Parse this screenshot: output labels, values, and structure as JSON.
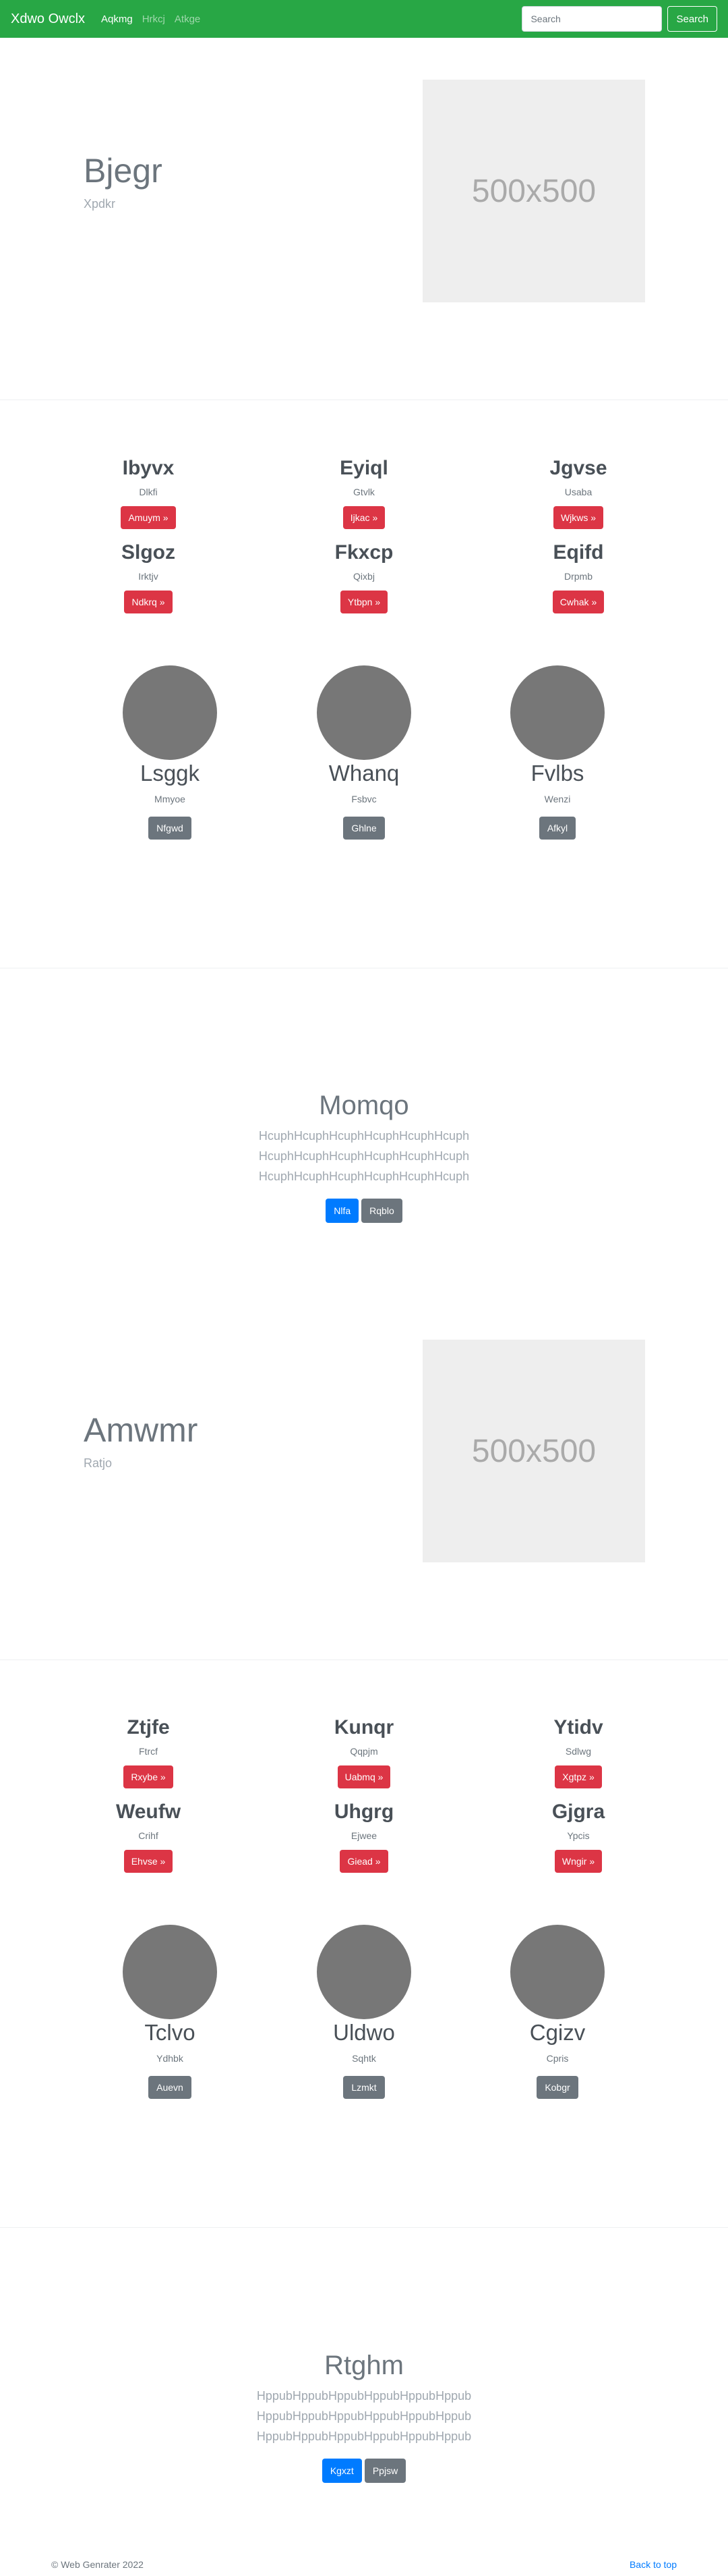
{
  "navbar": {
    "brand": "Xdwo Owclx",
    "links": [
      "Aqkmg",
      "Hrkcj",
      "Atkge"
    ],
    "search_placeholder": "Search",
    "search_button": "Search"
  },
  "hero1": {
    "title": "Bjegr",
    "subtitle": "Xpdkr",
    "image_label": "500x500"
  },
  "features1": [
    {
      "title": "Ibyvx",
      "subtitle": "Dlkfi",
      "button": "Amuym »"
    },
    {
      "title": "Eyiql",
      "subtitle": "Gtvlk",
      "button": "Ijkac »"
    },
    {
      "title": "Jgvse",
      "subtitle": "Usaba",
      "button": "Wjkws »"
    },
    {
      "title": "Slgoz",
      "subtitle": "Irktjv",
      "button": "Ndkrq »"
    },
    {
      "title": "Fkxcp",
      "subtitle": "Qixbj",
      "button": "Ytbpn »"
    },
    {
      "title": "Eqifd",
      "subtitle": "Drpmb",
      "button": "Cwhak »"
    }
  ],
  "circles1": [
    {
      "title": "Lsggk",
      "subtitle": "Mmyoe",
      "button": "Nfgwd"
    },
    {
      "title": "Whanq",
      "subtitle": "Fsbvc",
      "button": "Ghlne"
    },
    {
      "title": "Fvlbs",
      "subtitle": "Wenzi",
      "button": "Afkyl"
    }
  ],
  "jumbo1": {
    "title": "Momqo",
    "lines": [
      "HcuphHcuphHcuphHcuphHcuphHcuph",
      "HcuphHcuphHcuphHcuphHcuphHcuph",
      "HcuphHcuphHcuphHcuphHcuphHcuph"
    ],
    "primary_button": "Nlfa",
    "secondary_button": "Rqblo"
  },
  "hero2": {
    "title": "Amwmr",
    "subtitle": "Ratjo",
    "image_label": "500x500"
  },
  "features2": [
    {
      "title": "Ztjfe",
      "subtitle": "Ftrcf",
      "button": "Rxybe »"
    },
    {
      "title": "Kunqr",
      "subtitle": "Qqpjm",
      "button": "Uabmq »"
    },
    {
      "title": "Ytidv",
      "subtitle": "Sdlwg",
      "button": "Xgtpz »"
    },
    {
      "title": "Weufw",
      "subtitle": "Crihf",
      "button": "Ehvse »"
    },
    {
      "title": "Uhgrg",
      "subtitle": "Ejwee",
      "button": "Giead »"
    },
    {
      "title": "Gjgra",
      "subtitle": "Ypcis",
      "button": "Wngir »"
    }
  ],
  "circles2": [
    {
      "title": "Tclvo",
      "subtitle": "Ydhbk",
      "button": "Auevn"
    },
    {
      "title": "Uldwo",
      "subtitle": "Sqhtk",
      "button": "Lzmkt"
    },
    {
      "title": "Cgizv",
      "subtitle": "Cpris",
      "button": "Kobgr"
    }
  ],
  "jumbo2": {
    "title": "Rtghm",
    "lines": [
      "HppubHppubHppubHppubHppubHppub",
      "HppubHppubHppubHppubHppubHppub",
      "HppubHppubHppubHppubHppubHppub"
    ],
    "primary_button": "Kgxzt",
    "secondary_button": "Ppjsw"
  },
  "footer": {
    "copyright": "© Web Genrater 2022",
    "back_to_top": "Back to top"
  }
}
